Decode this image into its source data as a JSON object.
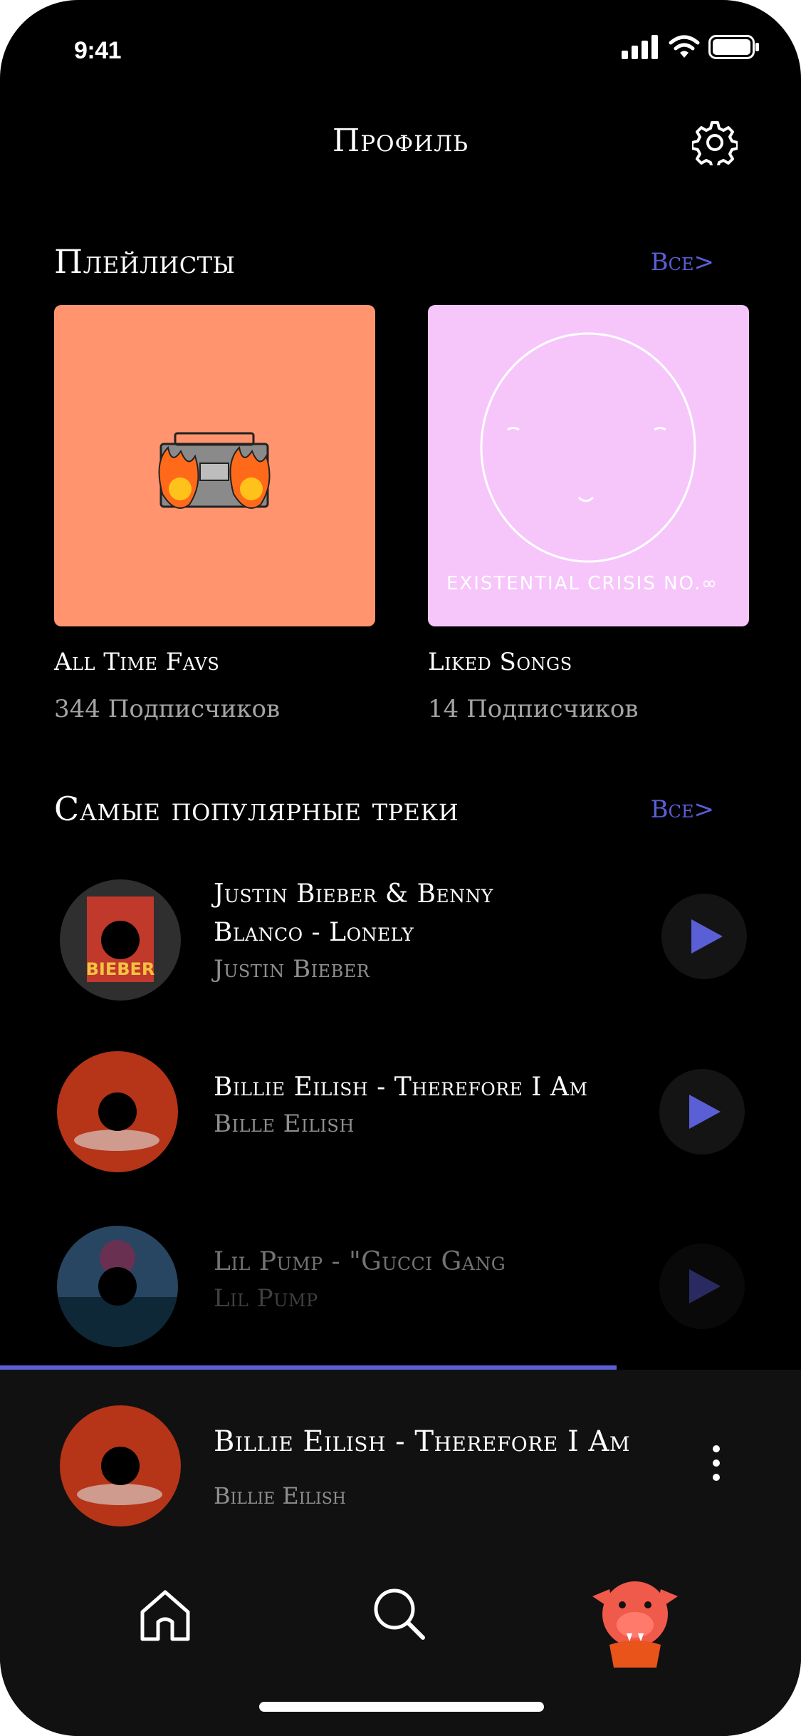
{
  "status_bar": {
    "time": "9:41",
    "icons": [
      "signal-icon",
      "wifi-icon",
      "battery-icon"
    ]
  },
  "header": {
    "title": "Профиль",
    "settings_icon": "gear-icon"
  },
  "playlists_section": {
    "title": "Плейлисты",
    "see_all": "Все>",
    "items": [
      {
        "name": "All Time Favs",
        "subscribers": "344 Подписчиков",
        "cover_color": "#ff946e"
      },
      {
        "name": "Liked Songs",
        "subscribers": "14 Подписчиков",
        "cover_color": "#f6c6fb",
        "cover_text": "EXISTENTIAL CRISIS NO.∞"
      }
    ]
  },
  "tracks_section": {
    "title": "Самые популярные треки",
    "see_all": "Все>",
    "items": [
      {
        "title_line1": "Justin Bieber & Benny",
        "title_line2": "Blanco - Lonely",
        "artist": "Justin Bieber",
        "cover_text": "BIEBER"
      },
      {
        "title_line1": "Billie Eilish - Therefore I Am",
        "artist": "Bille Eilish"
      },
      {
        "title_line1": "Lil Pump - \"Gucci Gang",
        "artist": "Lil Pump"
      }
    ]
  },
  "now_playing": {
    "title": "Billie Eilish - Therefore I Am",
    "artist": "Billie Eilish",
    "progress": 0.77
  },
  "tab_bar": {
    "items": [
      "home-icon",
      "search-icon",
      "profile-avatar"
    ]
  },
  "colors": {
    "accent": "#5b5fd6",
    "background": "#000000",
    "player_bg": "#111111"
  }
}
